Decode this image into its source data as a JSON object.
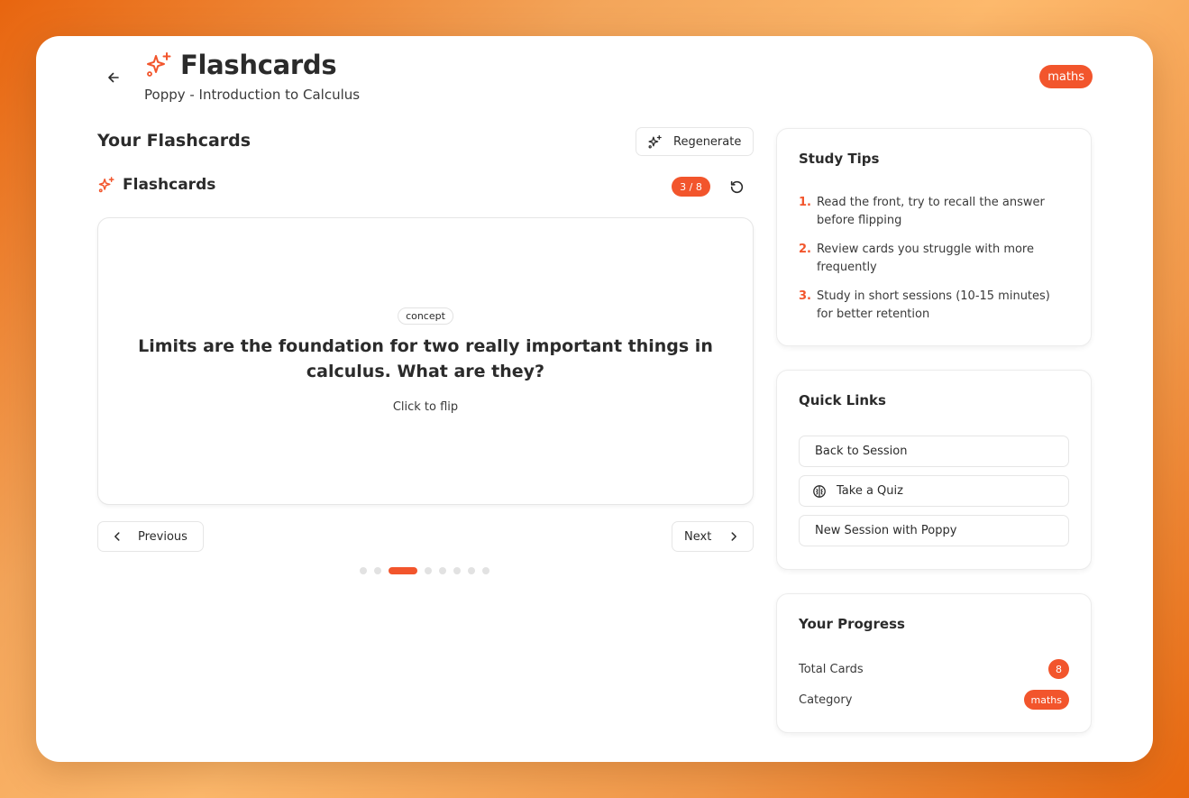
{
  "header": {
    "title": "Flashcards",
    "subtitle": "Poppy - Introduction to Calculus",
    "category_badge": "maths"
  },
  "main": {
    "section_title": "Your Flashcards",
    "regenerate_label": "Regenerate",
    "flashcards_label": "Flashcards",
    "counter": "3 / 8",
    "current_card": {
      "tag": "concept",
      "question": "Limits are the foundation for two really important things in calculus. What are they?",
      "hint": "Click to flip"
    },
    "previous_label": "Previous",
    "next_label": "Next",
    "total_dots": 8,
    "active_dot": 3
  },
  "study_tips": {
    "title": "Study Tips",
    "tips": [
      {
        "num": "1.",
        "text": "Read the front, try to recall the answer before flipping"
      },
      {
        "num": "2.",
        "text": "Review cards you struggle with more frequently"
      },
      {
        "num": "3.",
        "text": "Study in short sessions (10-15 minutes) for better retention"
      }
    ]
  },
  "quick_links": {
    "title": "Quick Links",
    "items": [
      {
        "label": "Back to Session",
        "icon": ""
      },
      {
        "label": "Take a Quiz",
        "icon": "brain-icon"
      },
      {
        "label": "New Session with Poppy",
        "icon": ""
      }
    ]
  },
  "progress": {
    "title": "Your Progress",
    "total_cards_label": "Total Cards",
    "total_cards_value": "8",
    "category_label": "Category",
    "category_value": "maths"
  },
  "colors": {
    "accent": "#f2552c",
    "background_gradient_start": "#e8650f",
    "background_gradient_mid": "#fdb96c"
  }
}
